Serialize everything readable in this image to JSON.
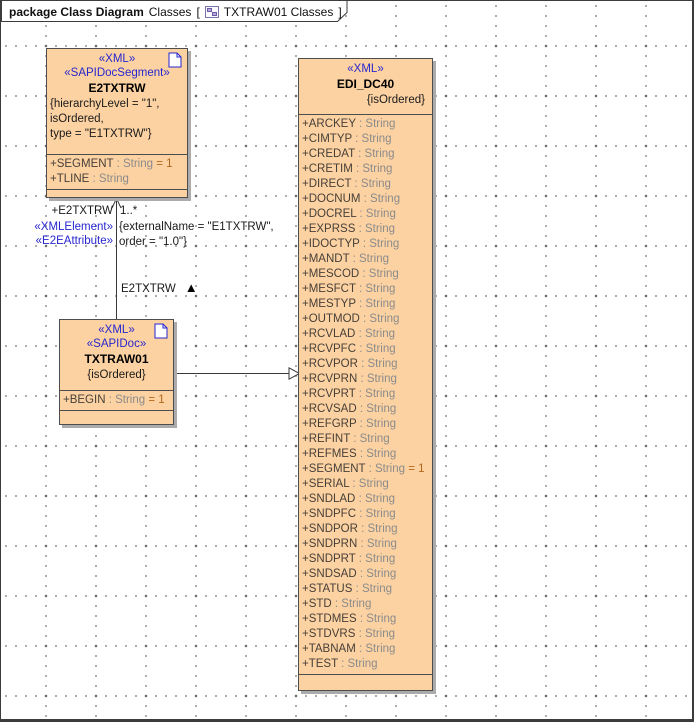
{
  "frame": {
    "title_bold": "package Class Diagram",
    "title_plain": "Classes",
    "bracket_open": "[",
    "diagram_name": "TXTRAW01 Classes",
    "bracket_close": "]",
    "icon": "class-diagram-icon"
  },
  "colors": {
    "class_fill": "#fcd2a2",
    "class_border": "#4d4d4d",
    "stereotype_blue": "#2626cf",
    "attr_type_gray": "#8b8b8b",
    "attr_default_brown": "#b1681c",
    "shadow_gray": "#ababab"
  },
  "classes": {
    "e2txtrw": {
      "stereotypes": [
        "«XML»",
        "«SAPIDocSegment»"
      ],
      "name": "E2TXTRW",
      "constraints": [
        "{hierarchyLevel = \"1\",",
        "isOrdered,",
        "type = \"E1TXTRW\"}"
      ],
      "attributes": [
        {
          "name": "+SEGMENT",
          "type": " : String",
          "default": " = 1"
        },
        {
          "name": "+TLINE",
          "type": " : String",
          "default": ""
        }
      ],
      "icon": "doc-icon"
    },
    "txtraw01": {
      "stereotypes": [
        "«XML»",
        "«SAPIDoc»"
      ],
      "name": "TXTRAW01",
      "constraints": [
        "{isOrdered}"
      ],
      "attributes": [
        {
          "name": "+BEGIN",
          "type": " : String",
          "default": " = 1"
        }
      ],
      "icon": "doc-icon"
    },
    "edi_dc40": {
      "stereotypes": [
        "«XML»"
      ],
      "name": "EDI_DC40",
      "constraint": "{isOrdered}",
      "attributes": [
        {
          "name": "+ARCKEY",
          "type": " : String",
          "default": ""
        },
        {
          "name": "+CIMTYP",
          "type": " : String",
          "default": ""
        },
        {
          "name": "+CREDAT",
          "type": " : String",
          "default": ""
        },
        {
          "name": "+CRETIM",
          "type": " : String",
          "default": ""
        },
        {
          "name": "+DIRECT",
          "type": " : String",
          "default": ""
        },
        {
          "name": "+DOCNUM",
          "type": " : String",
          "default": ""
        },
        {
          "name": "+DOCREL",
          "type": " : String",
          "default": ""
        },
        {
          "name": "+EXPRSS",
          "type": " : String",
          "default": ""
        },
        {
          "name": "+IDOCTYP",
          "type": " : String",
          "default": ""
        },
        {
          "name": "+MANDT",
          "type": " : String",
          "default": ""
        },
        {
          "name": "+MESCOD",
          "type": " : String",
          "default": ""
        },
        {
          "name": "+MESFCT",
          "type": " : String",
          "default": ""
        },
        {
          "name": "+MESTYP",
          "type": " : String",
          "default": ""
        },
        {
          "name": "+OUTMOD",
          "type": " : String",
          "default": ""
        },
        {
          "name": "+RCVLAD",
          "type": " : String",
          "default": ""
        },
        {
          "name": "+RCVPFC",
          "type": " : String",
          "default": ""
        },
        {
          "name": "+RCVPOR",
          "type": " : String",
          "default": ""
        },
        {
          "name": "+RCVPRN",
          "type": " : String",
          "default": ""
        },
        {
          "name": "+RCVPRT",
          "type": " : String",
          "default": ""
        },
        {
          "name": "+RCVSAD",
          "type": " : String",
          "default": ""
        },
        {
          "name": "+REFGRP",
          "type": " : String",
          "default": ""
        },
        {
          "name": "+REFINT",
          "type": " : String",
          "default": ""
        },
        {
          "name": "+REFMES",
          "type": " : String",
          "default": ""
        },
        {
          "name": "+SEGMENT",
          "type": " : String",
          "default": " = 1"
        },
        {
          "name": "+SERIAL",
          "type": " : String",
          "default": ""
        },
        {
          "name": "+SNDLAD",
          "type": " : String",
          "default": ""
        },
        {
          "name": "+SNDPFC",
          "type": " : String",
          "default": ""
        },
        {
          "name": "+SNDPOR",
          "type": " : String",
          "default": ""
        },
        {
          "name": "+SNDPRN",
          "type": " : String",
          "default": ""
        },
        {
          "name": "+SNDPRT",
          "type": " : String",
          "default": ""
        },
        {
          "name": "+SNDSAD",
          "type": " : String",
          "default": ""
        },
        {
          "name": "+STATUS",
          "type": " : String",
          "default": ""
        },
        {
          "name": "+STD",
          "type": " : String",
          "default": ""
        },
        {
          "name": "+STDMES",
          "type": " : String",
          "default": ""
        },
        {
          "name": "+STDVRS",
          "type": " : String",
          "default": ""
        },
        {
          "name": "+TABNAM",
          "type": " : String",
          "default": ""
        },
        {
          "name": "+TEST",
          "type": " : String",
          "default": ""
        }
      ]
    }
  },
  "association": {
    "role": "+E2TXTRW",
    "multiplicity": "1..*",
    "stereotypes": [
      "«XMLElement»",
      "«E2EAttribute»"
    ],
    "constraint_line1": "{externalName = \"E1TXTRW\",",
    "constraint_line2": "order = \"1.0\"}",
    "name": "E2TXTRW",
    "direction_glyph": "▲"
  }
}
